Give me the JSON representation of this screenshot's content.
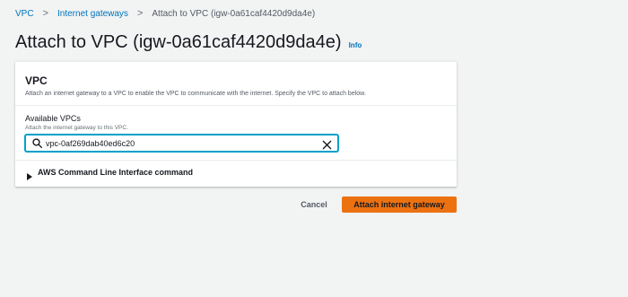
{
  "breadcrumb": {
    "items": [
      {
        "label": "VPC"
      },
      {
        "label": "Internet gateways"
      },
      {
        "label": "Attach to VPC (igw-0a61caf4420d9da4e)"
      }
    ],
    "separator": ">"
  },
  "page": {
    "title": "Attach to VPC (igw-0a61caf4420d9da4e)",
    "info_label": "Info"
  },
  "panel": {
    "title": "VPC",
    "description": "Attach an internet gateway to a VPC to enable the VPC to communicate with the internet. Specify the VPC to attach below.",
    "field": {
      "label": "Available VPCs",
      "description": "Attach the internet gateway to this VPC.",
      "value": "vpc-0af269dab40ed6c20",
      "placeholder": ""
    },
    "cli_label": "AWS Command Line Interface command"
  },
  "actions": {
    "cancel_label": "Cancel",
    "attach_label": "Attach internet gateway"
  },
  "colors": {
    "link": "#0073bb",
    "primary_button": "#ec7211",
    "focus_border": "#00a1c9",
    "background": "#f2f3f3"
  },
  "icons": [
    "search-icon",
    "clear-icon",
    "caret-right-icon"
  ]
}
